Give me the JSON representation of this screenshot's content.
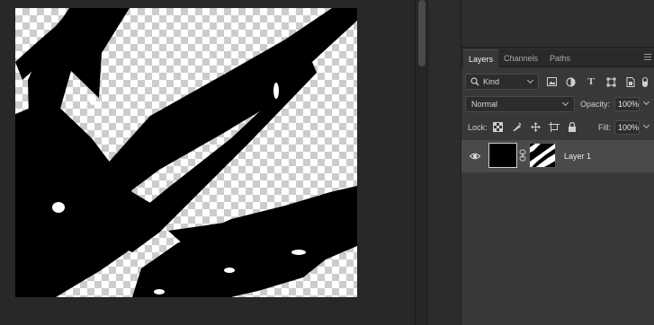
{
  "layers_panel": {
    "tabs": [
      {
        "label": "Layers",
        "active": true
      },
      {
        "label": "Channels",
        "active": false
      },
      {
        "label": "Paths",
        "active": false
      }
    ],
    "filter": {
      "kind_label": "Kind",
      "filter_icons": [
        "image-filter-icon",
        "adjustment-filter-icon",
        "type-filter-icon",
        "shape-filter-icon",
        "smart-object-filter-icon"
      ]
    },
    "blend_mode": "Normal",
    "opacity_label": "Opacity:",
    "opacity_value": "100%",
    "lock_label": "Lock:",
    "lock_icons": [
      "lock-transparent-pixels-icon",
      "lock-image-pixels-icon",
      "lock-position-icon",
      "lock-artboard-icon",
      "lock-all-icon"
    ],
    "fill_label": "Fill:",
    "fill_value": "100%",
    "layers": [
      {
        "name": "Layer 1",
        "visible": true,
        "selected": true,
        "has_mask": true
      }
    ]
  },
  "colors": {
    "app_background": "#282828",
    "panel_background": "#383838",
    "selected_layer": "#4a4a4a",
    "canvas_fill": "#000000"
  }
}
